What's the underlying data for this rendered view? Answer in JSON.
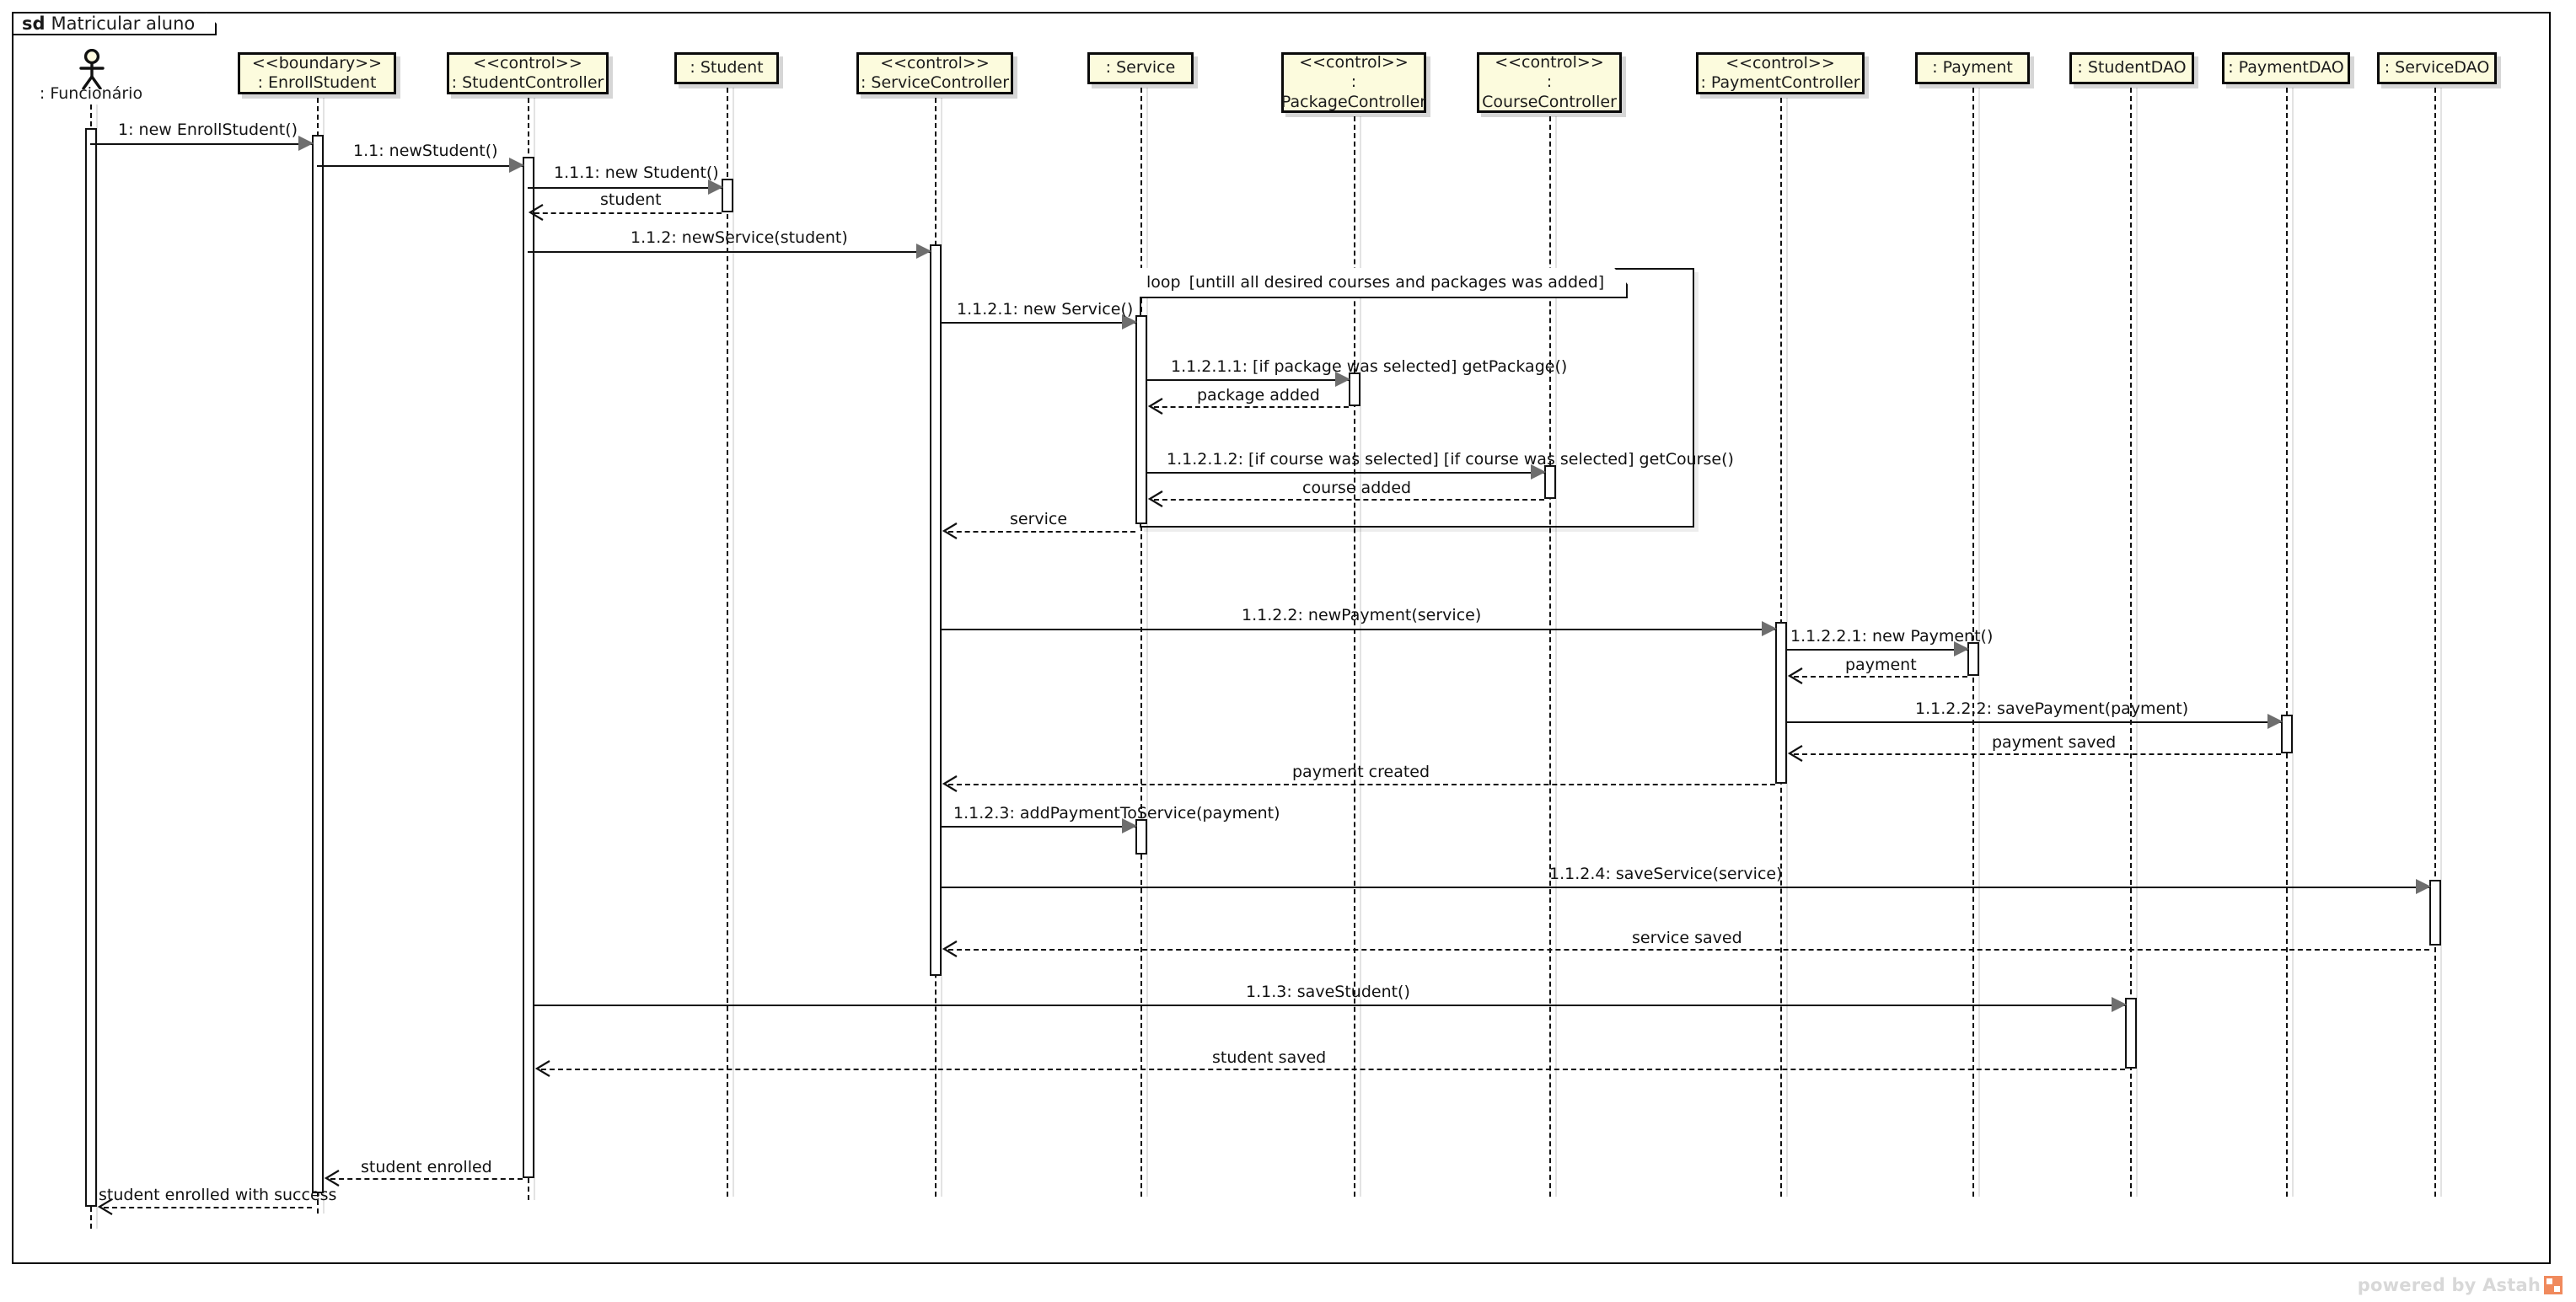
{
  "diagram": {
    "kind_keyword": "sd",
    "title": "Matricular aluno",
    "watermark": "powered by Astah"
  },
  "actor": {
    "name": ": Funcionário",
    "icon": "actor-stick-figure"
  },
  "lifelines": [
    {
      "id": "enrollstudent",
      "stereotype": "<<boundary>>",
      "name": ": EnrollStudent",
      "lines": [
        "<<boundary>>",
        ": EnrollStudent"
      ]
    },
    {
      "id": "studentcontroller",
      "stereotype": "<<control>>",
      "name": ": StudentController",
      "lines": [
        "<<control>>",
        ": StudentController"
      ]
    },
    {
      "id": "student",
      "stereotype": "",
      "name": ": Student",
      "lines": [
        ": Student"
      ]
    },
    {
      "id": "servicecontroller",
      "stereotype": "<<control>>",
      "name": ": ServiceController",
      "lines": [
        "<<control>>",
        ": ServiceController"
      ]
    },
    {
      "id": "service",
      "stereotype": "",
      "name": ": Service",
      "lines": [
        ": Service"
      ]
    },
    {
      "id": "packagecontroller",
      "stereotype": "<<control>>",
      "name": ": PackageController",
      "lines": [
        "<<control>>",
        ":",
        "PackageController"
      ]
    },
    {
      "id": "coursecontroller",
      "stereotype": "<<control>>",
      "name": ": CourseController",
      "lines": [
        "<<control>>",
        ":",
        "CourseController"
      ]
    },
    {
      "id": "paymentcontroller",
      "stereotype": "<<control>>",
      "name": ": PaymentController",
      "lines": [
        "<<control>>",
        ": PaymentController"
      ]
    },
    {
      "id": "payment",
      "stereotype": "",
      "name": ": Payment",
      "lines": [
        ": Payment"
      ]
    },
    {
      "id": "studentdao",
      "stereotype": "",
      "name": ": StudentDAO",
      "lines": [
        ": StudentDAO"
      ]
    },
    {
      "id": "paymentdao",
      "stereotype": "",
      "name": ": PaymentDAO",
      "lines": [
        ": PaymentDAO"
      ]
    },
    {
      "id": "servicedao",
      "stereotype": "",
      "name": ": ServiceDAO",
      "lines": [
        ": ServiceDAO"
      ]
    }
  ],
  "fragment": {
    "operator": "loop",
    "guard": "[untill all desired courses and packages was added]"
  },
  "messages": [
    {
      "id": "m1",
      "label": "1: new EnrollStudent()"
    },
    {
      "id": "m2",
      "label": "1.1: newStudent()"
    },
    {
      "id": "m3",
      "label": "1.1.1: new Student()"
    },
    {
      "id": "m4",
      "label": "student"
    },
    {
      "id": "m5",
      "label": "1.1.2: newService(student)"
    },
    {
      "id": "m6",
      "label": "1.1.2.1: new Service()"
    },
    {
      "id": "m7",
      "label": "1.1.2.1.1: [if package was selected] getPackage()"
    },
    {
      "id": "m8",
      "label": "package added"
    },
    {
      "id": "m9",
      "label": "1.1.2.1.2: [if course was selected] [if course was selected] getCourse()"
    },
    {
      "id": "m10",
      "label": "course added"
    },
    {
      "id": "m11",
      "label": "service"
    },
    {
      "id": "m12",
      "label": "1.1.2.2: newPayment(service)"
    },
    {
      "id": "m13",
      "label": "1.1.2.2.1: new Payment()"
    },
    {
      "id": "m14",
      "label": "payment"
    },
    {
      "id": "m15",
      "label": "1.1.2.2.2: savePayment(payment)"
    },
    {
      "id": "m16",
      "label": "payment saved"
    },
    {
      "id": "m17",
      "label": "payment created"
    },
    {
      "id": "m18",
      "label": "1.1.2.3: addPaymentToService(payment)"
    },
    {
      "id": "m19",
      "label": "1.1.2.4: saveService(service)"
    },
    {
      "id": "m20",
      "label": "service saved"
    },
    {
      "id": "m21",
      "label": "1.1.3: saveStudent()"
    },
    {
      "id": "m22",
      "label": "student saved"
    },
    {
      "id": "m23",
      "label": "student enrolled"
    },
    {
      "id": "m24",
      "label": "student enrolled with success"
    }
  ],
  "colors": {
    "lifeline_fill": "#fcfbdd",
    "lifeline_border": "#0a0a0a",
    "line": "#111111",
    "arrow_fill": "#6e6e6e",
    "watermark": "#d8d8d8",
    "watermark_logo": "#f08a5d"
  }
}
